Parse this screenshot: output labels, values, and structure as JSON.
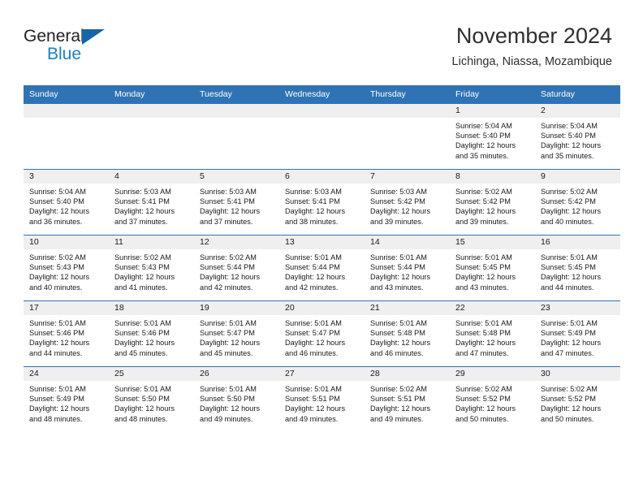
{
  "brand": {
    "name_part1": "General",
    "name_part2": "Blue",
    "colors": {
      "dark": "#231f20",
      "blue": "#1b7fc3",
      "triangle": "#1665a8"
    }
  },
  "header": {
    "title": "November 2024",
    "subtitle": "Lichinga, Niassa, Mozambique"
  },
  "calendar": {
    "header_color": "#3073b4",
    "daynum_band_color": "#efefef",
    "weekday_headers": [
      "Sunday",
      "Monday",
      "Tuesday",
      "Wednesday",
      "Thursday",
      "Friday",
      "Saturday"
    ],
    "weeks": [
      [
        {
          "day": "",
          "info": ""
        },
        {
          "day": "",
          "info": ""
        },
        {
          "day": "",
          "info": ""
        },
        {
          "day": "",
          "info": ""
        },
        {
          "day": "",
          "info": ""
        },
        {
          "day": "1",
          "info": "Sunrise: 5:04 AM\nSunset: 5:40 PM\nDaylight: 12 hours\nand 35 minutes."
        },
        {
          "day": "2",
          "info": "Sunrise: 5:04 AM\nSunset: 5:40 PM\nDaylight: 12 hours\nand 35 minutes."
        }
      ],
      [
        {
          "day": "3",
          "info": "Sunrise: 5:04 AM\nSunset: 5:40 PM\nDaylight: 12 hours\nand 36 minutes."
        },
        {
          "day": "4",
          "info": "Sunrise: 5:03 AM\nSunset: 5:41 PM\nDaylight: 12 hours\nand 37 minutes."
        },
        {
          "day": "5",
          "info": "Sunrise: 5:03 AM\nSunset: 5:41 PM\nDaylight: 12 hours\nand 37 minutes."
        },
        {
          "day": "6",
          "info": "Sunrise: 5:03 AM\nSunset: 5:41 PM\nDaylight: 12 hours\nand 38 minutes."
        },
        {
          "day": "7",
          "info": "Sunrise: 5:03 AM\nSunset: 5:42 PM\nDaylight: 12 hours\nand 39 minutes."
        },
        {
          "day": "8",
          "info": "Sunrise: 5:02 AM\nSunset: 5:42 PM\nDaylight: 12 hours\nand 39 minutes."
        },
        {
          "day": "9",
          "info": "Sunrise: 5:02 AM\nSunset: 5:42 PM\nDaylight: 12 hours\nand 40 minutes."
        }
      ],
      [
        {
          "day": "10",
          "info": "Sunrise: 5:02 AM\nSunset: 5:43 PM\nDaylight: 12 hours\nand 40 minutes."
        },
        {
          "day": "11",
          "info": "Sunrise: 5:02 AM\nSunset: 5:43 PM\nDaylight: 12 hours\nand 41 minutes."
        },
        {
          "day": "12",
          "info": "Sunrise: 5:02 AM\nSunset: 5:44 PM\nDaylight: 12 hours\nand 42 minutes."
        },
        {
          "day": "13",
          "info": "Sunrise: 5:01 AM\nSunset: 5:44 PM\nDaylight: 12 hours\nand 42 minutes."
        },
        {
          "day": "14",
          "info": "Sunrise: 5:01 AM\nSunset: 5:44 PM\nDaylight: 12 hours\nand 43 minutes."
        },
        {
          "day": "15",
          "info": "Sunrise: 5:01 AM\nSunset: 5:45 PM\nDaylight: 12 hours\nand 43 minutes."
        },
        {
          "day": "16",
          "info": "Sunrise: 5:01 AM\nSunset: 5:45 PM\nDaylight: 12 hours\nand 44 minutes."
        }
      ],
      [
        {
          "day": "17",
          "info": "Sunrise: 5:01 AM\nSunset: 5:46 PM\nDaylight: 12 hours\nand 44 minutes."
        },
        {
          "day": "18",
          "info": "Sunrise: 5:01 AM\nSunset: 5:46 PM\nDaylight: 12 hours\nand 45 minutes."
        },
        {
          "day": "19",
          "info": "Sunrise: 5:01 AM\nSunset: 5:47 PM\nDaylight: 12 hours\nand 45 minutes."
        },
        {
          "day": "20",
          "info": "Sunrise: 5:01 AM\nSunset: 5:47 PM\nDaylight: 12 hours\nand 46 minutes."
        },
        {
          "day": "21",
          "info": "Sunrise: 5:01 AM\nSunset: 5:48 PM\nDaylight: 12 hours\nand 46 minutes."
        },
        {
          "day": "22",
          "info": "Sunrise: 5:01 AM\nSunset: 5:48 PM\nDaylight: 12 hours\nand 47 minutes."
        },
        {
          "day": "23",
          "info": "Sunrise: 5:01 AM\nSunset: 5:49 PM\nDaylight: 12 hours\nand 47 minutes."
        }
      ],
      [
        {
          "day": "24",
          "info": "Sunrise: 5:01 AM\nSunset: 5:49 PM\nDaylight: 12 hours\nand 48 minutes."
        },
        {
          "day": "25",
          "info": "Sunrise: 5:01 AM\nSunset: 5:50 PM\nDaylight: 12 hours\nand 48 minutes."
        },
        {
          "day": "26",
          "info": "Sunrise: 5:01 AM\nSunset: 5:50 PM\nDaylight: 12 hours\nand 49 minutes."
        },
        {
          "day": "27",
          "info": "Sunrise: 5:01 AM\nSunset: 5:51 PM\nDaylight: 12 hours\nand 49 minutes."
        },
        {
          "day": "28",
          "info": "Sunrise: 5:02 AM\nSunset: 5:51 PM\nDaylight: 12 hours\nand 49 minutes."
        },
        {
          "day": "29",
          "info": "Sunrise: 5:02 AM\nSunset: 5:52 PM\nDaylight: 12 hours\nand 50 minutes."
        },
        {
          "day": "30",
          "info": "Sunrise: 5:02 AM\nSunset: 5:52 PM\nDaylight: 12 hours\nand 50 minutes."
        }
      ]
    ]
  }
}
